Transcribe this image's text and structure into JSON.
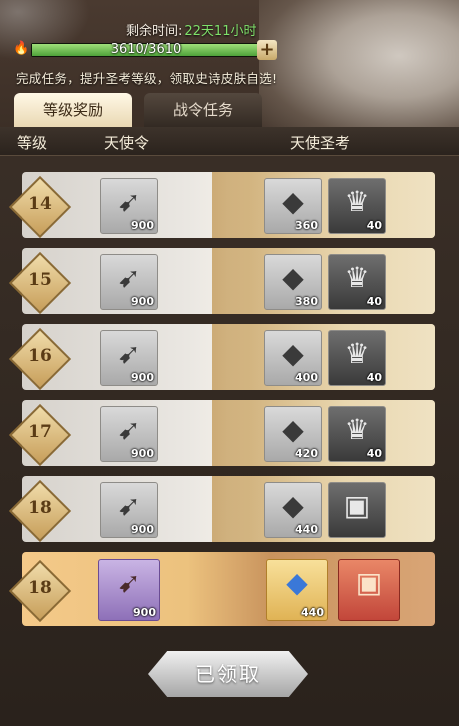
{
  "header": {
    "timer_label": "剩余时间:",
    "timer_value": "22天11小时",
    "progress_text": "3610/3610",
    "progress_fraction": 1.0,
    "plus_label": "+",
    "description": "完成任务，提升圣考等级，领取史诗皮肤自选!"
  },
  "tabs": [
    {
      "label": "等级奖励",
      "active": true
    },
    {
      "label": "战令任务",
      "active": false
    }
  ],
  "columns": {
    "level": "等级",
    "free": "天使令",
    "premium": "天使圣考"
  },
  "rows": [
    {
      "level": "14",
      "free_qty": "900",
      "p1_qty": "360",
      "p2_qty": "40"
    },
    {
      "level": "15",
      "free_qty": "900",
      "p1_qty": "380",
      "p2_qty": "40"
    },
    {
      "level": "16",
      "free_qty": "900",
      "p1_qty": "400",
      "p2_qty": "40"
    },
    {
      "level": "17",
      "free_qty": "900",
      "p1_qty": "420",
      "p2_qty": "40"
    },
    {
      "level": "18",
      "free_qty": "900",
      "p1_qty": "440",
      "p2_qty": ""
    }
  ],
  "special_row": {
    "level": "18",
    "free_qty": "900",
    "p1_qty": "440"
  },
  "claim_button": "已领取"
}
